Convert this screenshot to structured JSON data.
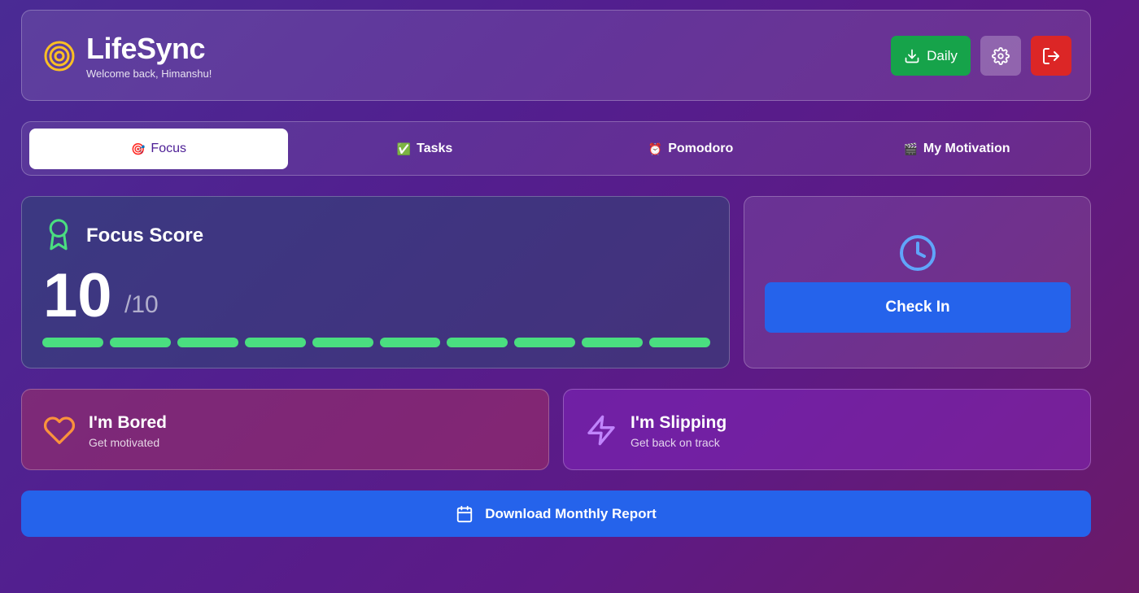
{
  "header": {
    "app_title": "LifeSync",
    "welcome": "Welcome back, Himanshu!",
    "daily_label": "Daily",
    "logo_icon": "target-icon",
    "settings_icon": "gear-icon",
    "logout_icon": "logout-icon"
  },
  "tabs": [
    {
      "label": "Focus",
      "emoji": "🎯",
      "active": true
    },
    {
      "label": "Tasks",
      "emoji": "✅",
      "active": false
    },
    {
      "label": "Pomodoro",
      "emoji": "⏰",
      "active": false
    },
    {
      "label": "My Motivation",
      "emoji": "🎬",
      "active": false
    }
  ],
  "focus": {
    "title": "Focus Score",
    "score": "10",
    "max": "/10",
    "filled_segments": 10,
    "total_segments": 10
  },
  "checkin": {
    "label": "Check In",
    "icon": "clock-icon"
  },
  "bored": {
    "title": "I'm Bored",
    "subtitle": "Get motivated",
    "icon": "heart-icon"
  },
  "slipping": {
    "title": "I'm Slipping",
    "subtitle": "Get back on track",
    "icon": "lightning-icon"
  },
  "download": {
    "label": "Download Monthly Report",
    "icon": "calendar-icon"
  },
  "colors": {
    "green": "#16a34a",
    "red": "#dc2626",
    "blue": "#2563eb",
    "progress": "#4ade80"
  }
}
